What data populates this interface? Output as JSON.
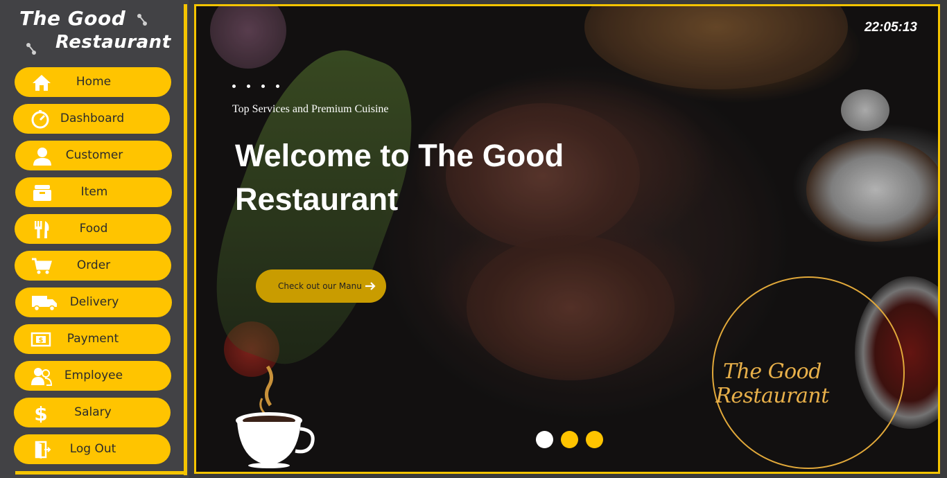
{
  "brand": {
    "line1": "The Good",
    "line2": "Restaurant"
  },
  "sidebar": {
    "items": [
      {
        "label": "Home",
        "icon": "home-icon"
      },
      {
        "label": "Dashboard",
        "icon": "dashboard-icon"
      },
      {
        "label": "Customer",
        "icon": "customer-icon"
      },
      {
        "label": "Item",
        "icon": "item-icon"
      },
      {
        "label": "Food",
        "icon": "food-icon"
      },
      {
        "label": "Order",
        "icon": "cart-icon"
      },
      {
        "label": "Delivery",
        "icon": "truck-icon"
      },
      {
        "label": "Payment",
        "icon": "payment-icon"
      },
      {
        "label": "Employee",
        "icon": "employee-icon"
      },
      {
        "label": "Salary",
        "icon": "dollar-icon"
      },
      {
        "label": "Log Out",
        "icon": "logout-icon"
      }
    ]
  },
  "hero": {
    "clock": "22:05:13",
    "tagline": "Top Services and Premium Cuisine",
    "welcome": "Welcome to The Good Restaurant",
    "menu_button": "Check out our Manu",
    "seal_text": "The Good Restaurant",
    "slider": {
      "count": 3,
      "active_index": 0
    }
  },
  "colors": {
    "accent": "#ffc400",
    "sidebar_bg": "#424245",
    "seal": "#e2a93a",
    "dot_active": "#ffffff",
    "dot_inactive": "#ffc400"
  }
}
